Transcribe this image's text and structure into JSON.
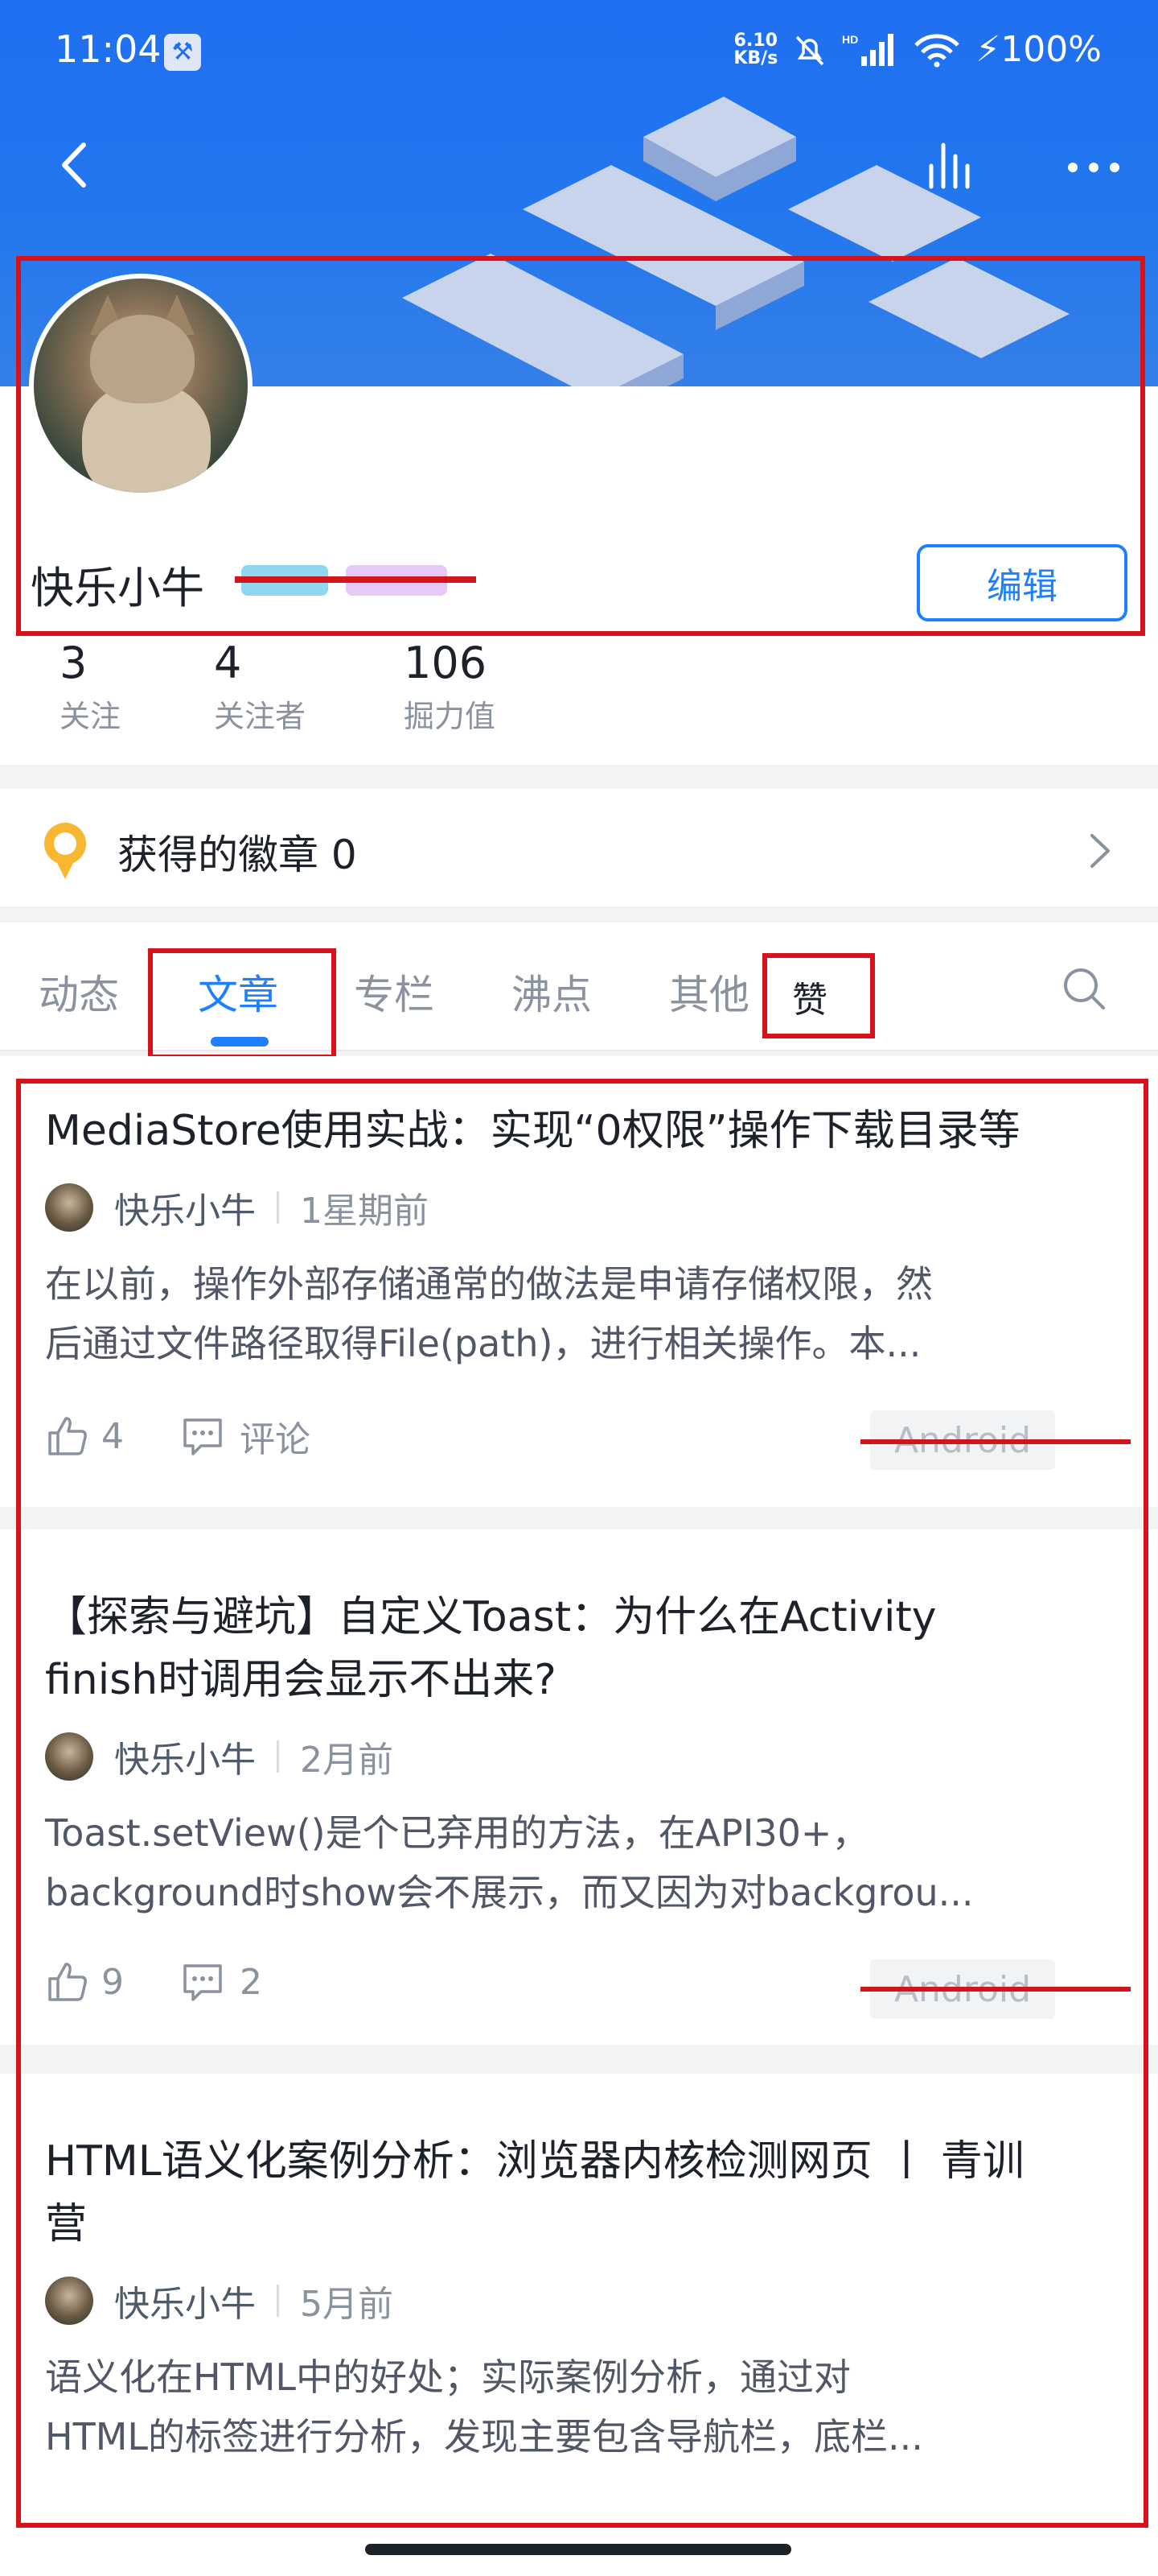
{
  "status_bar": {
    "time": "11:04",
    "speed_value": "6.10",
    "speed_unit": "KB/s",
    "network": "HD",
    "battery": "100%"
  },
  "profile": {
    "username": "快乐小牛",
    "edit_label": "编辑",
    "stats": [
      {
        "value": "3",
        "label": "关注"
      },
      {
        "value": "4",
        "label": "关注者"
      },
      {
        "value": "106",
        "label": "掘力值"
      }
    ]
  },
  "badges": {
    "label": "获得的徽章 0"
  },
  "tabs": [
    {
      "label": "动态"
    },
    {
      "label": "文章"
    },
    {
      "label": "专栏"
    },
    {
      "label": "沸点"
    },
    {
      "label": "其他"
    },
    {
      "label": "赞"
    }
  ],
  "articles": [
    {
      "title": "MediaStore使用实战：实现“0权限”操作下载目录等",
      "author": "快乐小牛",
      "time": "1星期前",
      "summary_line1": "在以前，操作外部存储通常的做法是申请存储权限，然",
      "summary_line2": "后通过文件路径取得File(path)，进行相关操作。本...",
      "likes": "4",
      "comments": "评论",
      "tag": "Android"
    },
    {
      "title_line1": "【探索与避坑】自定义Toast：为什么在Activity",
      "title_line2": "finish时调用会显示不出来?",
      "author": "快乐小牛",
      "time": "2月前",
      "summary_line1": "Toast.setView()是个已弃用的方法，在API30+，",
      "summary_line2": "background时show会不展示，而又因为对backgrou...",
      "likes": "9",
      "comments": "2",
      "tag": "Android"
    },
    {
      "title_line1": "HTML语义化案例分析：浏览器内核检测网页 丨 青训",
      "title_line2": "营",
      "author": "快乐小牛",
      "time": "5月前",
      "summary_line1": "语义化在HTML中的好处；实际案例分析，通过对",
      "summary_line2": "HTML的标签进行分析，发现主要包含导航栏，底栏..."
    }
  ],
  "colors": {
    "brand": "#1e80ff",
    "annotation_red": "#d8121a",
    "banner": "#1f6ff0"
  }
}
